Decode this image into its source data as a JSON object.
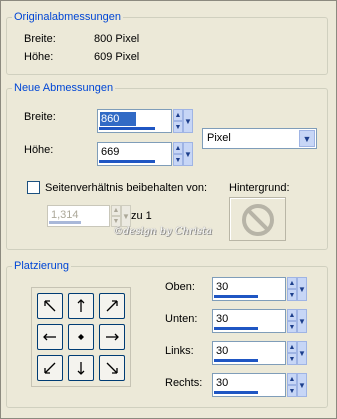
{
  "original_dimensions": {
    "legend": "Originalabmessungen",
    "width_label": "Breite:",
    "width_value": "800 Pixel",
    "height_label": "Höhe:",
    "height_value": "609 Pixel"
  },
  "new_dimensions": {
    "legend": "Neue Abmessungen",
    "width_label": "Breite:",
    "width_value": "860",
    "height_label": "Höhe:",
    "height_value": "669",
    "unit_selected": "Pixel",
    "aspect_checkbox_label": "Seitenverhältnis beibehalten von:",
    "aspect_checked": false,
    "aspect_value": "1,314",
    "aspect_suffix": "zu 1",
    "background_label": "Hintergrund:"
  },
  "placement": {
    "legend": "Platzierung",
    "top_label": "Oben:",
    "top_value": "30",
    "bottom_label": "Unten:",
    "bottom_value": "30",
    "left_label": "Links:",
    "left_value": "30",
    "right_label": "Rechts:",
    "right_value": "30",
    "anchors": [
      "arrow-up-left",
      "arrow-up",
      "arrow-up-right",
      "arrow-left",
      "center-dot",
      "arrow-right",
      "arrow-down-left",
      "arrow-down",
      "arrow-down-right"
    ]
  },
  "watermark": "©design by Christa",
  "colors": {
    "dialog_bg": "#ECE9D8",
    "legend_text": "#0046D5",
    "selection": "#316AC5",
    "spin_button": "#C7D6F6",
    "input_border": "#7F9DB9"
  }
}
